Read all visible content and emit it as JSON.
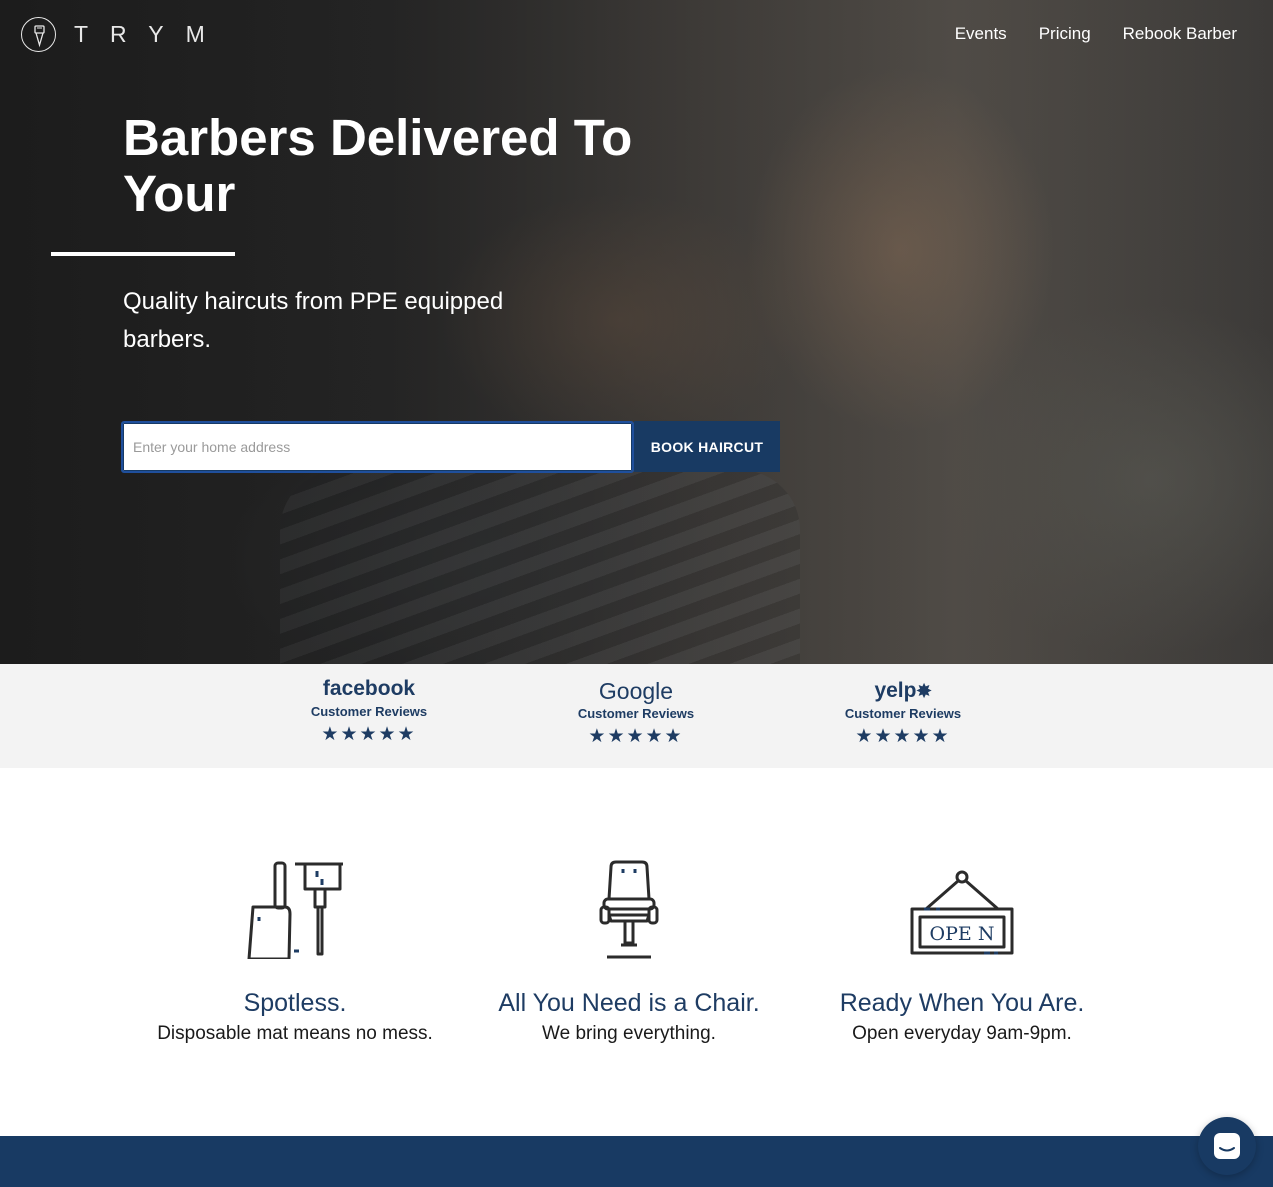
{
  "brand": {
    "name": "TRYM"
  },
  "nav": {
    "items": [
      "Events",
      "Pricing",
      "Rebook Barber"
    ]
  },
  "hero": {
    "title": "Barbers Delivered To Your",
    "subtitle": "Quality haircuts from PPE equipped barbers.",
    "address_placeholder": "Enter your home address",
    "book_button": "BOOK HAIRCUT"
  },
  "reviews": [
    {
      "brand": "facebook",
      "caption": "Customer Reviews",
      "stars": "★★★★★",
      "rating": 5
    },
    {
      "brand": "Google",
      "caption": "Customer Reviews",
      "stars": "★★★★★",
      "rating": 5
    },
    {
      "brand": "yelp",
      "caption": "Customer Reviews",
      "stars": "★★★★★",
      "rating": 5
    }
  ],
  "features": [
    {
      "icon": "dustpan-brush-icon",
      "title": "Spotless.",
      "subtitle": "Disposable mat means no mess."
    },
    {
      "icon": "barber-chair-icon",
      "title": "All You Need is a Chair.",
      "subtitle": "We bring everything."
    },
    {
      "icon": "open-sign-icon",
      "title": "Ready When You Are.",
      "subtitle": "Open everyday 9am-9pm.",
      "sign_text": "OPE N"
    }
  ],
  "colors": {
    "primary": "#183a63",
    "accent_text": "#1e3c63",
    "reviews_bg": "#f3f3f3"
  }
}
